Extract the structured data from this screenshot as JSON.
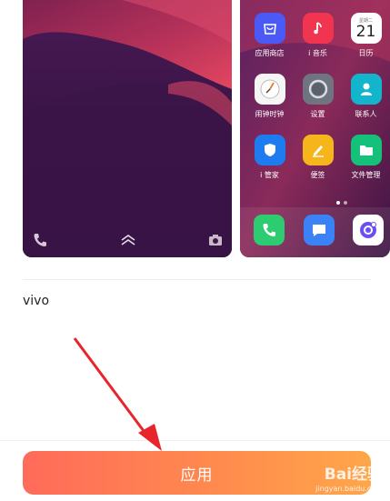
{
  "lock_preview": {
    "icons": [
      "phone-icon",
      "chevron-up-icon",
      "camera-icon"
    ]
  },
  "home_preview": {
    "apps": [
      {
        "label": "应用商店",
        "icon": "app-store-icon",
        "color": "#4b59f5"
      },
      {
        "label": "i 音乐",
        "icon": "music-icon",
        "color": "#f1344f"
      },
      {
        "label": "日历",
        "icon": "calendar-icon",
        "color": "#ffffff",
        "day": "21",
        "weekday": "星期二"
      },
      {
        "label": "闹钟时钟",
        "icon": "clock-icon",
        "color": "#f5f5f5"
      },
      {
        "label": "设置",
        "icon": "settings-icon",
        "color": "#6e7480"
      },
      {
        "label": "联系人",
        "icon": "contacts-icon",
        "color": "#12b5cb"
      },
      {
        "label": "i 管家",
        "icon": "shield-icon",
        "color": "#1f7cf0"
      },
      {
        "label": "便签",
        "icon": "notes-icon",
        "color": "#f7b51c"
      },
      {
        "label": "文件管理",
        "icon": "folder-icon",
        "color": "#15c07a"
      }
    ],
    "dock": [
      {
        "icon": "phone-icon",
        "color": "#2ecc71"
      },
      {
        "icon": "message-icon",
        "color": "#3b82f6"
      },
      {
        "icon": "browser-icon",
        "color": "#ffffff"
      }
    ]
  },
  "theme": {
    "name": "vivo"
  },
  "apply_label": "应用",
  "watermark": {
    "main": "Bai经验",
    "sub": "jingyan.baidu.com"
  },
  "colors": {
    "accent_start": "#ff6b5a",
    "accent_end": "#ffa64a",
    "annotation": "#e8252b"
  }
}
